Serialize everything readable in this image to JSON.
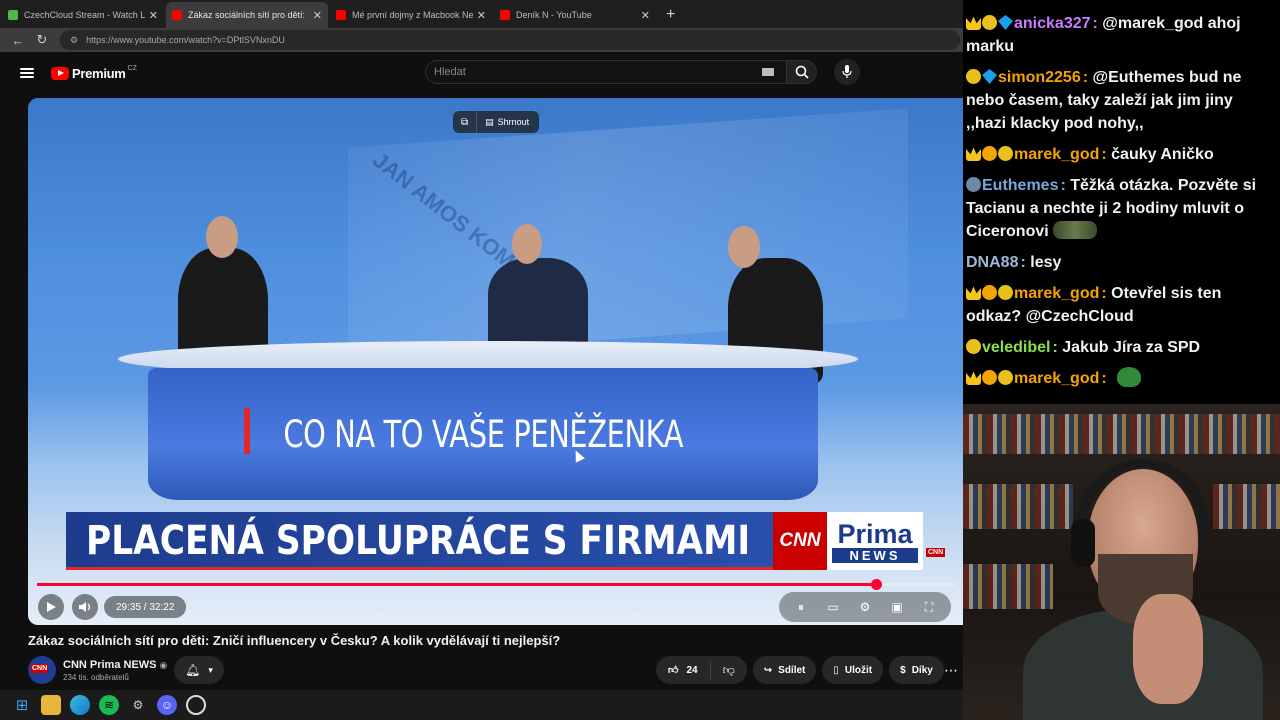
{
  "browser": {
    "tabs": [
      {
        "title": "CzechCloud Stream - Watch Live o",
        "favicon_color": "#53b84a",
        "active": false
      },
      {
        "title": "Zákaz sociálních sítí pro dětí:",
        "favicon_color": "#ff0000",
        "active": true
      },
      {
        "title": "Mé první dojmy z Macbook Neo.",
        "favicon_color": "#ff0000",
        "active": false
      },
      {
        "title": "Deník N - YouTube",
        "favicon_color": "#ff0000",
        "active": false
      }
    ],
    "new_tab_label": "+",
    "url": "https://www.youtube.com/watch?v=DPtlSVNxnDU"
  },
  "youtube": {
    "logo_text": "Premium",
    "country_code": "CZ",
    "search_placeholder": "Hledat"
  },
  "video": {
    "shrnout_label": "Shrnout",
    "desk_text": "CO NA TO VAŠE PENĚŽENKA",
    "lower_third_text": "PLACENÁ SPOLUPRÁCE S FIRMAMI",
    "cnn_text": "CNN",
    "prima_text": "Prima",
    "news_text": "NEWS",
    "banknote_text": "JAN AMOS KOMENSKÝ",
    "time_display": "29:35 / 32:22",
    "progress": 0.915,
    "title": "Zákaz sociálních sítí pro děti: Zničí influencery v Česku? A kolik vydělávají ti nejlepší?",
    "channel_name": "CNN Prima NEWS",
    "channel_subs": "234 tis. odběratelů",
    "likes": "24",
    "share_label": "Sdílet",
    "save_label": "Uložit",
    "thanks_label": "Díky"
  },
  "chat": {
    "messages": [
      {
        "badges": [
          "crown",
          "coin",
          "dia"
        ],
        "user": "anicka327",
        "user_color": "#c77dff",
        "text": "@marek_god ahoj marku"
      },
      {
        "badges": [
          "coin",
          "dia"
        ],
        "user": "simon2256",
        "user_color": "#f4a300",
        "text": "@Euthemes bud ne nebo časem, taky zaleží jak jim jiny ,,hazi klacky pod nohy,,"
      },
      {
        "badges": [
          "crown",
          "glob",
          "coin"
        ],
        "user": "marek_god",
        "user_color": "#f4a300",
        "text": "čauky Aničko"
      },
      {
        "badges": [
          "gray"
        ],
        "user": "Euthemes",
        "user_color": "#7aa7d9",
        "text": "Těžká otázka. Pozvěte si Tacianu a nechte ji 2 hodiny mluvit o Ciceronovi",
        "emote": "wide"
      },
      {
        "badges": [],
        "user": "DNA88",
        "user_color": "#9eb6d6",
        "text": "lesy"
      },
      {
        "badges": [
          "crown",
          "glob",
          "coin"
        ],
        "user": "marek_god",
        "user_color": "#f4a300",
        "text": "Otevřel sis ten odkaz? @CzechCloud"
      },
      {
        "badges": [
          "coin"
        ],
        "user": "veledibel",
        "user_color": "#8de04a",
        "text": "Jakub Jíra za SPD"
      },
      {
        "badges": [
          "crown",
          "glob",
          "coin"
        ],
        "user": "marek_god",
        "user_color": "#f4a300",
        "text": "",
        "emote": "frog"
      }
    ]
  }
}
